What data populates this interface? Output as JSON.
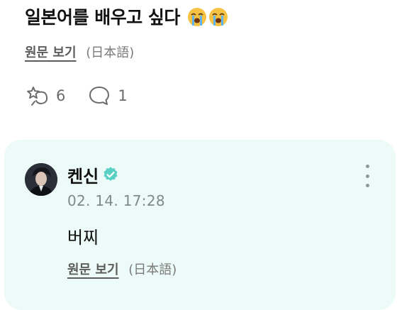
{
  "post": {
    "text": "일본어를 배우고 싶다",
    "emojis": [
      "loudly-crying-face",
      "loudly-crying-face"
    ],
    "translate_label": "원문 보기",
    "language_label": "(日本語)",
    "reaction_count": "6",
    "comment_count": "1"
  },
  "comment": {
    "author": "켄신",
    "verified": true,
    "timestamp": "02. 14. 17:28",
    "text": "버찌",
    "translate_label": "원문 보기",
    "language_label": "(日本語)"
  },
  "colors": {
    "comment_bg": "#ecfbf8",
    "verified_badge": "#5ad0c4",
    "muted_text": "#7a7a7a"
  }
}
